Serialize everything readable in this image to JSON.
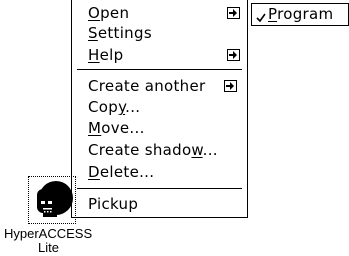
{
  "context_menu": {
    "items": [
      {
        "label_underlined": "O",
        "label_rest": "pen",
        "has_submenu": true
      },
      {
        "label_underlined": "S",
        "label_rest": "ettings",
        "has_submenu": false
      },
      {
        "label_underlined": "H",
        "label_rest": "elp",
        "has_submenu": true
      },
      {
        "label": "Create another",
        "has_submenu": true
      },
      {
        "label_before": "Cop",
        "label_underlined": "y",
        "label_rest": "...",
        "has_submenu": false
      },
      {
        "label_underlined": "M",
        "label_rest": "ove...",
        "has_submenu": false
      },
      {
        "label_before": "Create shado",
        "label_underlined": "w",
        "label_rest": "...",
        "has_submenu": false
      },
      {
        "label_underlined": "D",
        "label_rest": "elete...",
        "has_submenu": false
      },
      {
        "label": "Pickup",
        "has_submenu": false
      }
    ]
  },
  "submenu": {
    "checked": true,
    "label_underlined": "P",
    "label_rest": "rogram"
  },
  "desktop_icon": {
    "caption_line1": "HyperACCESS",
    "caption_line2": "Lite"
  }
}
